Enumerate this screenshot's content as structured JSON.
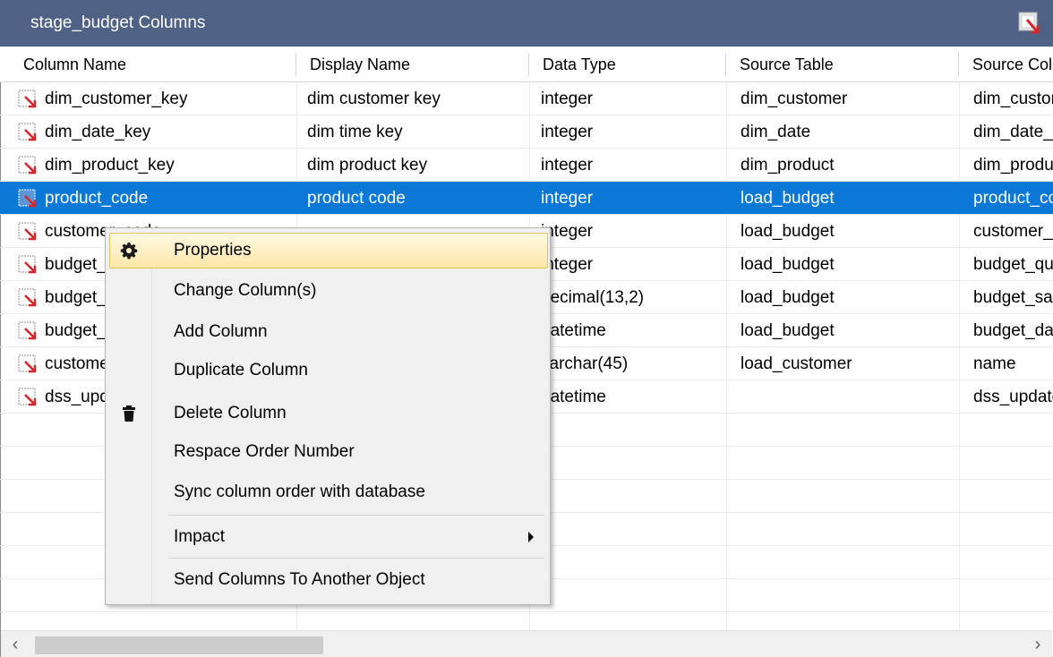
{
  "window": {
    "title": "stage_budget Columns",
    "close_icon": "pin-close-icon"
  },
  "columns": [
    "Column Name",
    "Display Name",
    "Data Type",
    "Source Table",
    "Source Column"
  ],
  "rows": [
    {
      "name": "dim_customer_key",
      "display": "dim customer key",
      "type": "integer",
      "source_table": "dim_customer",
      "source_column": "dim_customer_key"
    },
    {
      "name": "dim_date_key",
      "display": "dim time key",
      "type": "integer",
      "source_table": "dim_date",
      "source_column": "dim_date_key"
    },
    {
      "name": "dim_product_key",
      "display": "dim product key",
      "type": "integer",
      "source_table": "dim_product",
      "source_column": "dim_product_key"
    },
    {
      "name": "product_code",
      "display": "product code",
      "type": "integer",
      "source_table": "load_budget",
      "source_column": "product_code"
    },
    {
      "name": "customer_code",
      "display": "",
      "type": "integer",
      "source_table": "load_budget",
      "source_column": "customer_code"
    },
    {
      "name": "budget_quantity",
      "display": "",
      "type": "integer",
      "source_table": "load_budget",
      "source_column": "budget_quantity"
    },
    {
      "name": "budget_sales_value",
      "display": "",
      "type": "decimal(13,2)",
      "source_table": "load_budget",
      "source_column": "budget_sales_value"
    },
    {
      "name": "budget_date",
      "display": "",
      "type": "datetime",
      "source_table": "load_budget",
      "source_column": "budget_date"
    },
    {
      "name": "customer_name",
      "display": "",
      "type": "varchar(45)",
      "source_table": "load_customer",
      "source_column": "name"
    },
    {
      "name": "dss_update_time",
      "display": "",
      "type": "datetime",
      "source_table": "",
      "source_column": "dss_update_time"
    }
  ],
  "selected_row": 3,
  "context_menu": {
    "items": [
      {
        "label": "Properties",
        "icon": "gear-icon"
      },
      {
        "label": "Change Column(s)",
        "icon": ""
      },
      {
        "label": "Add Column",
        "icon": ""
      },
      {
        "label": "Duplicate Column",
        "icon": ""
      },
      {
        "label": "Delete Column",
        "icon": "trash-icon"
      },
      {
        "label": "Respace Order Number",
        "icon": ""
      },
      {
        "label": "Sync column order with database",
        "icon": ""
      },
      {
        "label": "Impact",
        "icon": "submenu-arrow-icon"
      },
      {
        "label": "Send Columns To Another Object",
        "icon": ""
      }
    ]
  },
  "colors": {
    "titlebar": "#4f6285",
    "selection": "#0a78d7",
    "menu_hover": "#ffe7a9"
  }
}
